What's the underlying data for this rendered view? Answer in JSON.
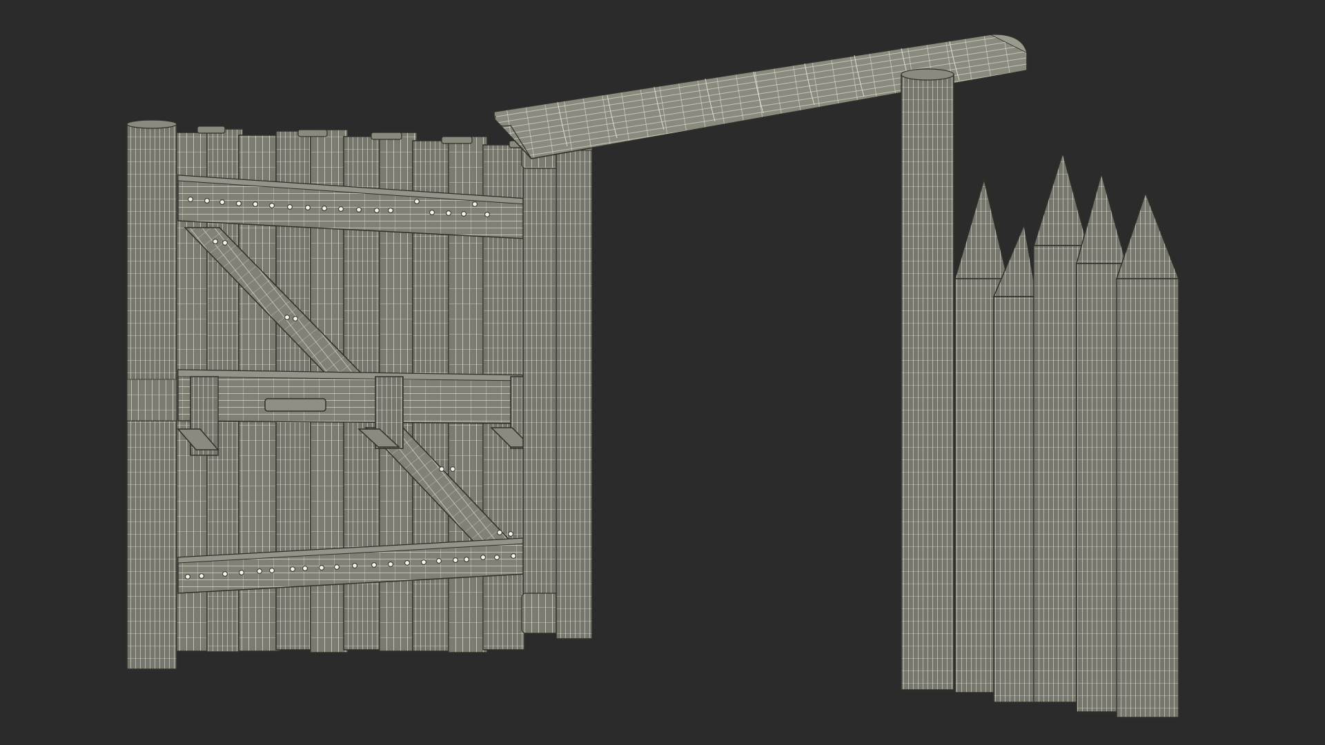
{
  "scene": {
    "subject": "wooden-gate-wireframe",
    "colors": {
      "background": "#2b2b2b",
      "surface": "#7b7b70",
      "surface_dark": "#6c6c62",
      "surface_light": "#8a8a7e",
      "wire": "#e6e6dc",
      "edge": "#2f2f2a",
      "bolt": "#f4f4ec"
    }
  }
}
